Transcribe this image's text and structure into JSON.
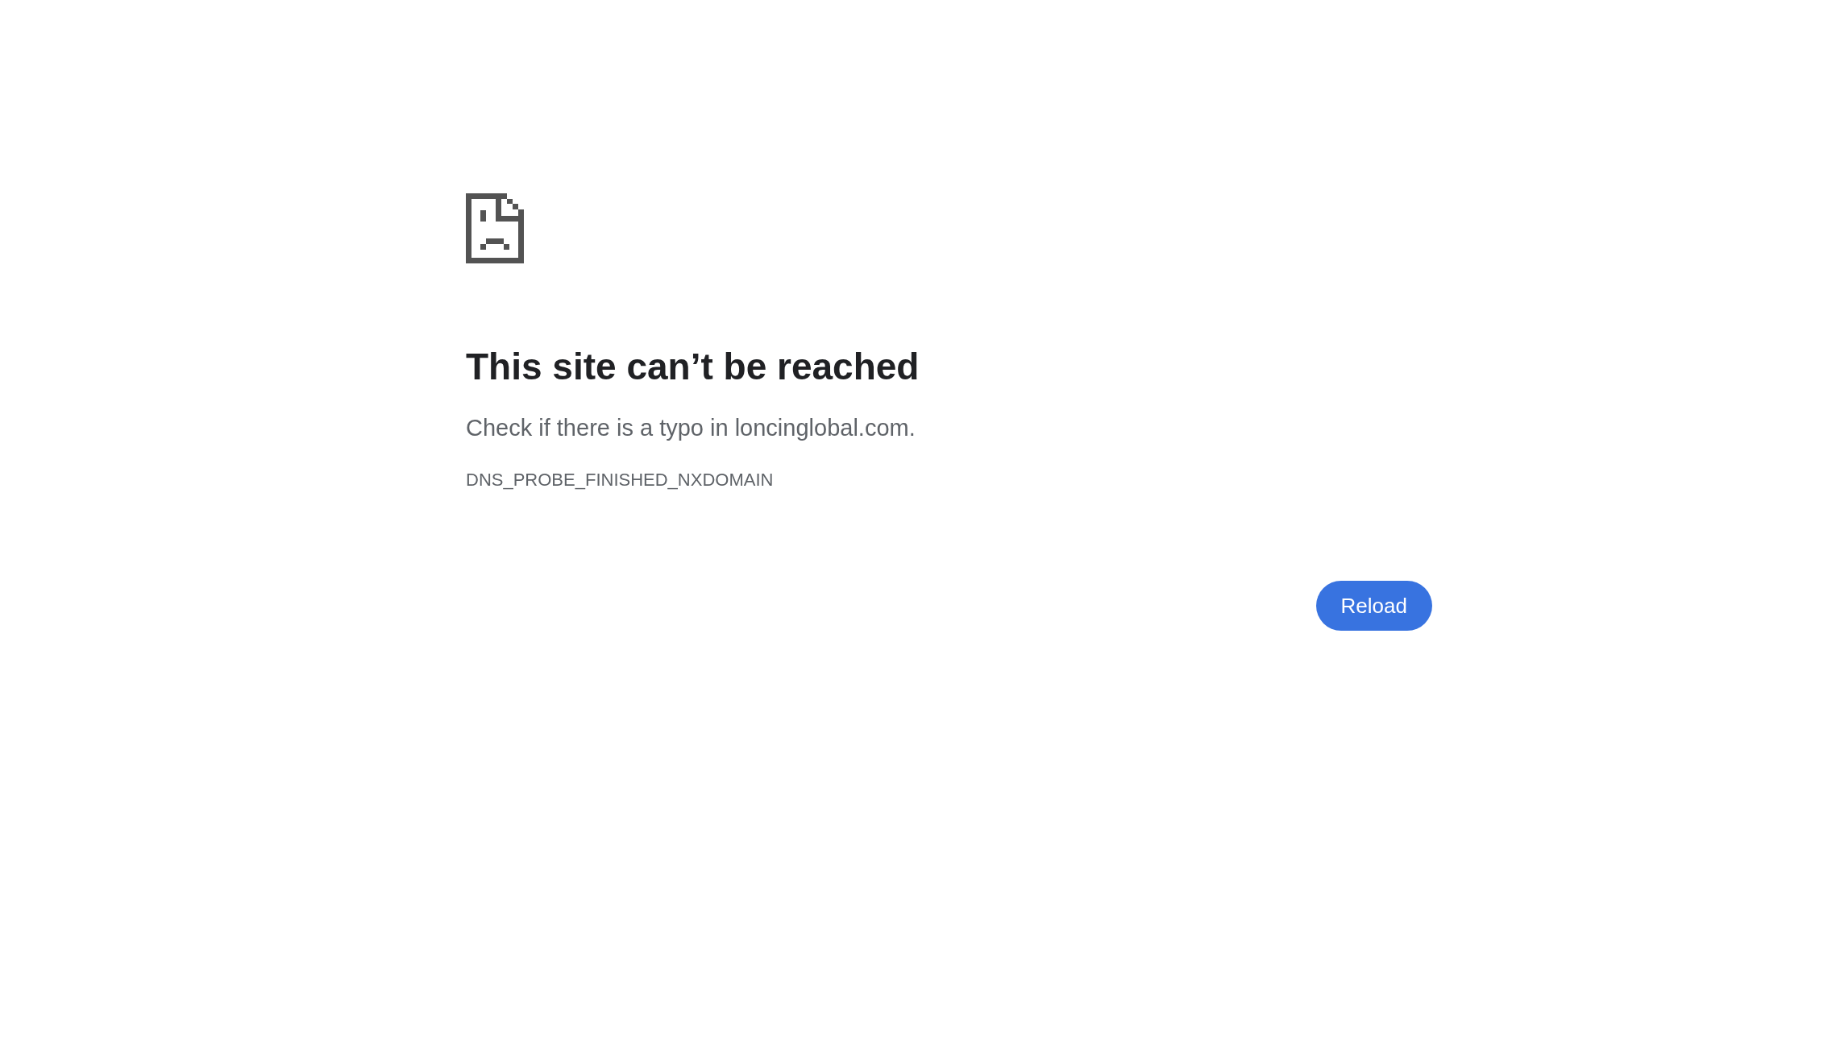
{
  "title": "This site can’t be reached",
  "message": "Check if there is a typo in loncinglobal.com.",
  "error_code": "DNS_PROBE_FINISHED_NXDOMAIN",
  "buttons": [
    "Reload"
  ]
}
